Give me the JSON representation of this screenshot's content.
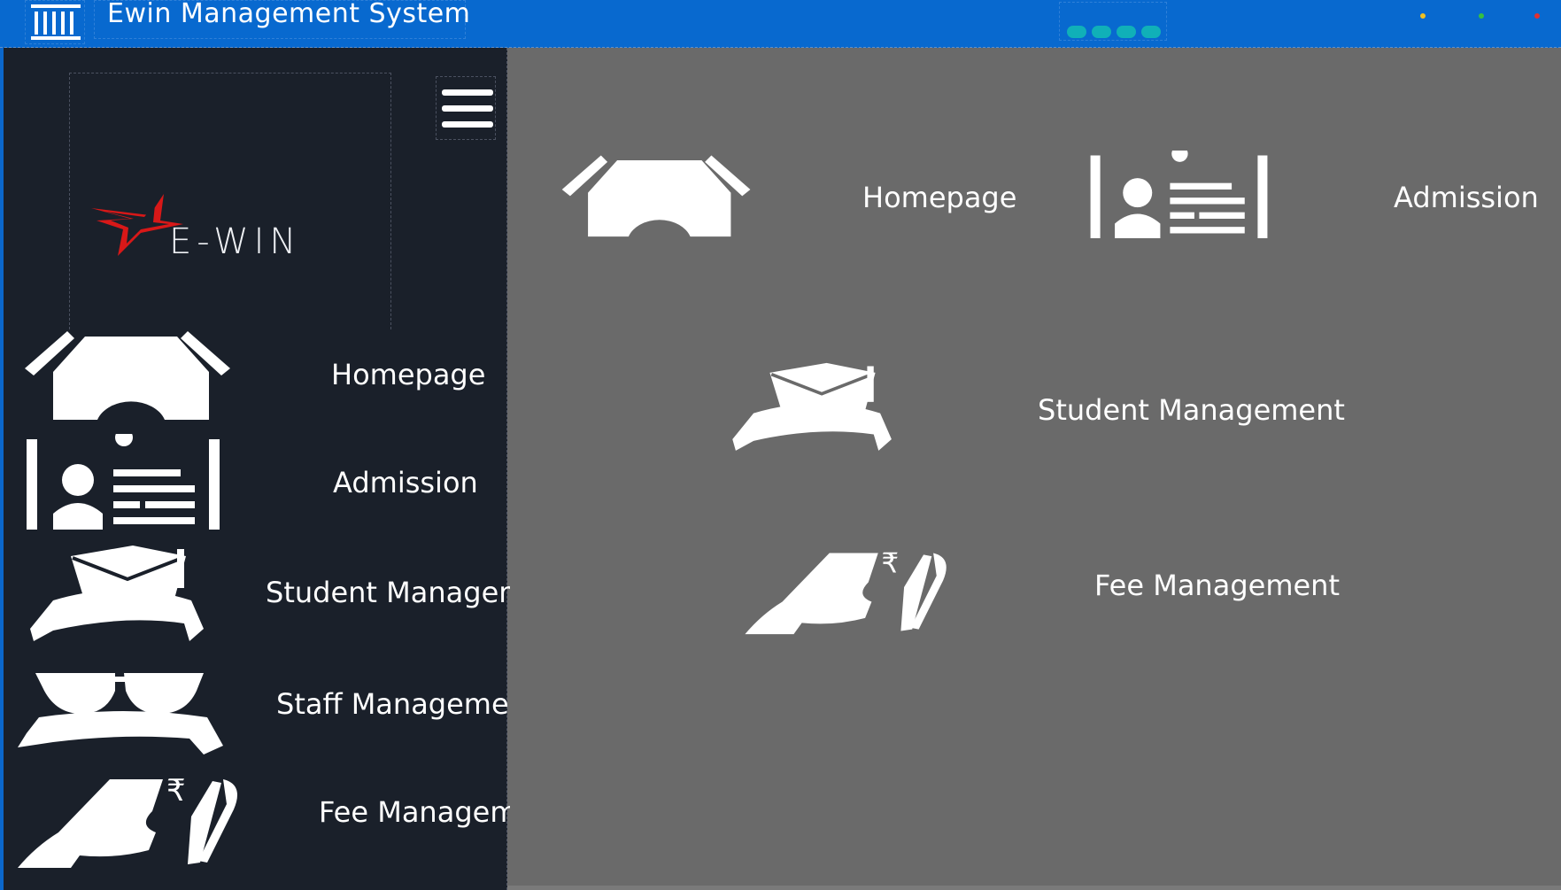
{
  "titlebar": {
    "title": "Ewin Management System",
    "app_icon": "institution-icon",
    "window_controls": {
      "minimize_color": "#f0c020",
      "maximize_color": "#36c040",
      "close_color": "#e03030"
    }
  },
  "sidebar": {
    "logo": {
      "text": "E-WIN",
      "icon": "red-star-logo-icon"
    },
    "menu_icon": "hamburger-icon",
    "items": [
      {
        "label": "Homepage",
        "icon": "home-icon"
      },
      {
        "label": "Admission",
        "icon": "id-card-icon"
      },
      {
        "label": "Student Manageme",
        "icon": "graduation-cap-icon"
      },
      {
        "label": "Staff Managemer",
        "icon": "teacher-glasses-icon"
      },
      {
        "label": "Fee Manageme",
        "icon": "fee-hand-rupee-icon"
      }
    ]
  },
  "main": {
    "tiles": [
      {
        "label": "Homepage",
        "icon": "home-icon"
      },
      {
        "label": "Admission",
        "icon": "id-card-icon"
      },
      {
        "label": "Student Management",
        "icon": "graduation-cap-icon"
      },
      {
        "label": "Fee Management",
        "icon": "fee-hand-rupee-icon"
      }
    ]
  },
  "colors": {
    "titlebar": "#0869cf",
    "sidebar": "#1a202a",
    "main": "#6a6a6a",
    "logo_accent": "#e01818"
  }
}
